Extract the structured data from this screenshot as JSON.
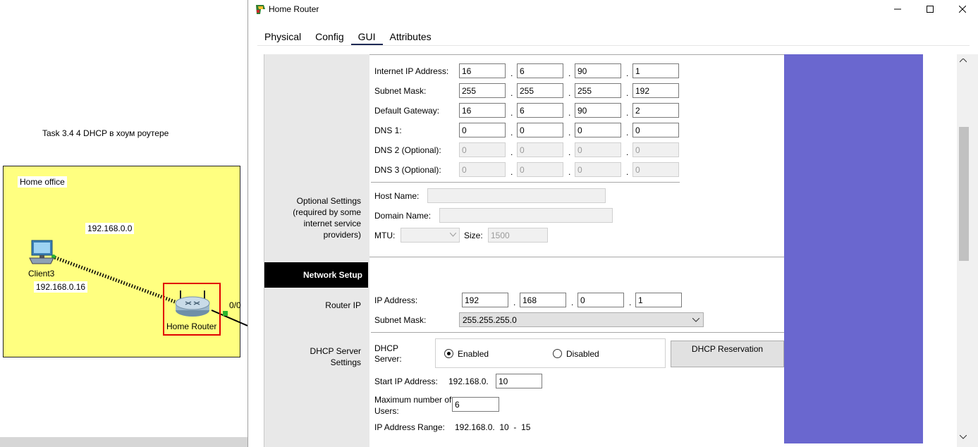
{
  "topology": {
    "task_label": "Task 3.4 4 DHCP в хоум роутере",
    "cluster_label": "Home office",
    "network_label": "192.168.0.0",
    "client_name": "Client3",
    "client_ip": "192.168.0.16",
    "router_name": "Home Router",
    "port_label": "0/0"
  },
  "window": {
    "title": "Home Router",
    "tabs": [
      {
        "label": "Physical"
      },
      {
        "label": "Config"
      },
      {
        "label": "GUI"
      },
      {
        "label": "Attributes"
      }
    ],
    "active_tab": "GUI"
  },
  "internet_setup": {
    "ip_label": "Internet IP Address:",
    "ip": [
      "16",
      "6",
      "90",
      "1"
    ],
    "mask_label": "Subnet Mask:",
    "mask": [
      "255",
      "255",
      "255",
      "192"
    ],
    "gateway_label": "Default Gateway:",
    "gateway": [
      "16",
      "6",
      "90",
      "2"
    ],
    "dns1_label": "DNS 1:",
    "dns1": [
      "0",
      "0",
      "0",
      "0"
    ],
    "dns2_label": "DNS 2 (Optional):",
    "dns2": [
      "0",
      "0",
      "0",
      "0"
    ],
    "dns3_label": "DNS 3 (Optional):",
    "dns3": [
      "0",
      "0",
      "0",
      "0"
    ]
  },
  "optional_settings": {
    "section_label": "Optional Settings (required by some internet service providers)",
    "host_name_label": "Host Name:",
    "host_name": "",
    "domain_name_label": "Domain Name:",
    "domain_name": "",
    "mtu_label": "MTU:",
    "mtu_value": "",
    "size_label": "Size:",
    "size_value": "1500"
  },
  "network_setup": {
    "header": "Network Setup",
    "router_ip_section": "Router IP",
    "ip_label": "IP Address:",
    "ip": [
      "192",
      "168",
      "0",
      "1"
    ],
    "mask_label": "Subnet Mask:",
    "mask_value": "255.255.255.0"
  },
  "dhcp": {
    "section_label": "DHCP Server Settings",
    "server_label": "DHCP Server:",
    "enabled_label": "Enabled",
    "disabled_label": "Disabled",
    "selected": "Enabled",
    "reservation_button": "DHCP Reservation",
    "start_ip_label": "Start IP Address:",
    "start_ip_prefix": "192.168.0.",
    "start_ip_value": "10",
    "max_users_label": "Maximum number of Users:",
    "max_users_value": "6",
    "range_label": "IP Address Range:",
    "range_value": "192.168.0.  10  -  15"
  },
  "colors": {
    "purple_panel": "#6a67cf",
    "cluster_fill": "#ffff80",
    "router_highlight": "#e00000",
    "tab_underline": "#1e2a55"
  }
}
